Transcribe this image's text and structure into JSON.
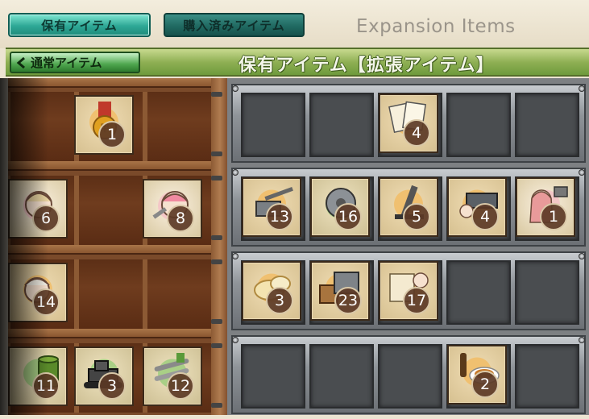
{
  "tabs": {
    "owned": "保有アイテム",
    "purchased": "購入済みアイテム"
  },
  "header_title": "Expansion Items",
  "back_button": "通常アイテム",
  "section_title": "保有アイテム【拡張アイテム】",
  "shelf_items": [
    {
      "icon": "medal-icon",
      "count": "1"
    },
    {
      "icon": "fairy-girl-icon",
      "count": "6"
    },
    {
      "icon": "repair-fairy-icon",
      "count": "8"
    },
    {
      "icon": "crew-fairy-icon",
      "count": "14"
    },
    {
      "icon": "fuel-drum-icon",
      "count": "11"
    },
    {
      "icon": "bulldozer-icon",
      "count": "3"
    },
    {
      "icon": "torpedo-parts-icon",
      "count": "12"
    }
  ],
  "panel_items": [
    {
      "icon": "documents-icon",
      "count": "4"
    },
    {
      "icon": "naval-gun-icon",
      "count": "13"
    },
    {
      "icon": "turbine-icon",
      "count": "16"
    },
    {
      "icon": "mortar-icon",
      "count": "5"
    },
    {
      "icon": "anti-air-fairy-icon",
      "count": "4"
    },
    {
      "icon": "catapult-girl-icon",
      "count": "1"
    },
    {
      "icon": "bread-icon",
      "count": "3"
    },
    {
      "icon": "supply-crates-icon",
      "count": "23"
    },
    {
      "icon": "blueprint-fairy-icon",
      "count": "17"
    },
    {
      "icon": "dinner-set-icon",
      "count": "2"
    }
  ]
}
